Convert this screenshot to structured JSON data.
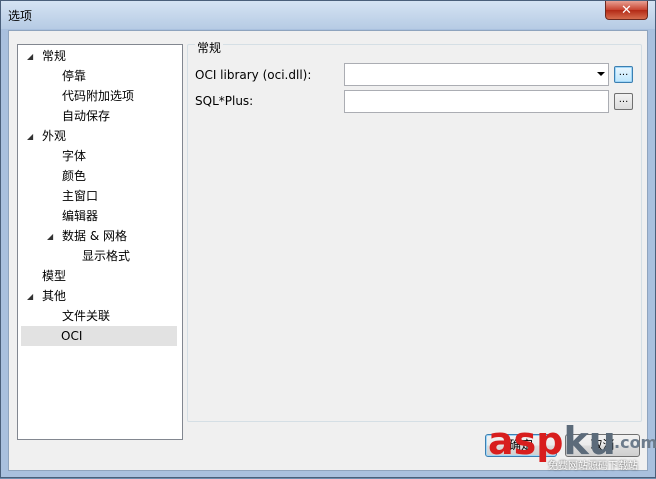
{
  "window": {
    "title": "选项",
    "close_glyph": "✕"
  },
  "tree": {
    "items": [
      {
        "label": "常规",
        "level": 0,
        "expanded": true
      },
      {
        "label": "停靠",
        "level": 1
      },
      {
        "label": "代码附加选项",
        "level": 1
      },
      {
        "label": "自动保存",
        "level": 1
      },
      {
        "label": "外观",
        "level": 0,
        "expanded": true
      },
      {
        "label": "字体",
        "level": 1
      },
      {
        "label": "颜色",
        "level": 1
      },
      {
        "label": "主窗口",
        "level": 1
      },
      {
        "label": "编辑器",
        "level": 1
      },
      {
        "label": "数据 & 网格",
        "level": 1,
        "expanded": true
      },
      {
        "label": "显示格式",
        "level": 2
      },
      {
        "label": "模型",
        "level": 0
      },
      {
        "label": "其他",
        "level": 0,
        "expanded": true
      },
      {
        "label": "文件关联",
        "level": 1
      },
      {
        "label": "OCI",
        "level": 1,
        "selected": true
      }
    ]
  },
  "panel": {
    "group_title": "常规",
    "oci_library_label": "OCI library (oci.dll):",
    "oci_library_value": "",
    "sqlplus_label": "SQL*Plus:",
    "sqlplus_value": "",
    "browse_label": "..."
  },
  "buttons": {
    "ok_label": "确定",
    "cancel_label": "取消"
  },
  "watermark": {
    "brand_red": "asp",
    "brand_gray": "ku",
    "suffix": ".com",
    "tagline": "免费网站源码下载站"
  }
}
